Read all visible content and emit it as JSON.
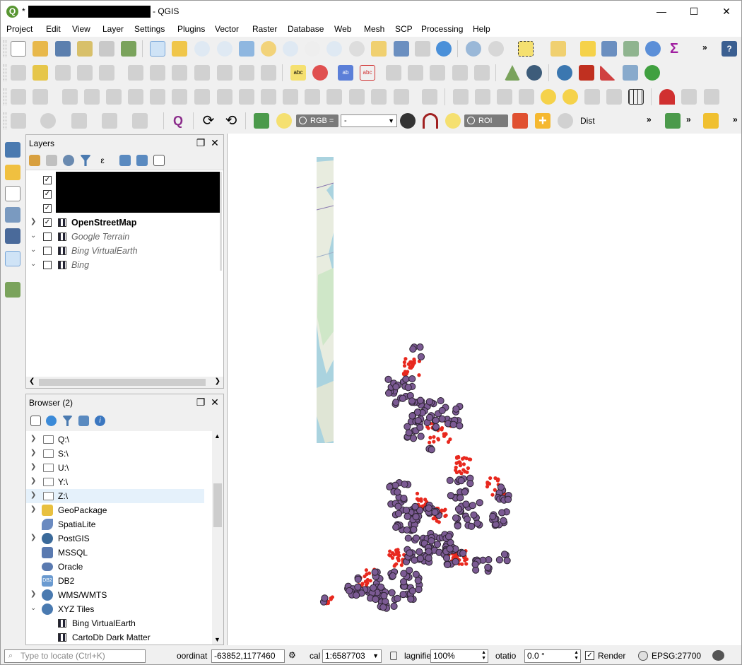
{
  "window": {
    "title_prefix": "*",
    "title_suffix": "- QGIS",
    "icon_letter": "Q",
    "minimize": "—",
    "maximize": "☐",
    "close": "✕"
  },
  "menu": [
    "Project",
    "Edit",
    "View",
    "Layer",
    "Settings",
    "Plugins",
    "Vector",
    "Raster",
    "Database",
    "Web",
    "Mesh",
    "SCP",
    "Processing",
    "Help"
  ],
  "toolbar4": {
    "rgb_label": "RGB =",
    "rgb_value": "-",
    "roi_label": "ROI",
    "dist_label": "Dist",
    "more": "»"
  },
  "layers_panel": {
    "title": "Layers",
    "layers": [
      {
        "name": "OpenStreetMap",
        "checked": true,
        "style": "bold"
      },
      {
        "name": "Google Terrain",
        "checked": false,
        "style": "italic"
      },
      {
        "name": "Bing VirtualEarth",
        "checked": false,
        "style": "italic"
      },
      {
        "name": "Bing",
        "checked": false,
        "style": "italic"
      }
    ]
  },
  "browser_panel": {
    "title": "Browser (2)",
    "items": [
      {
        "label": "Q:\\",
        "icon": "folder-icon",
        "expandable": true
      },
      {
        "label": "S:\\",
        "icon": "folder-icon",
        "expandable": true
      },
      {
        "label": "U:\\",
        "icon": "folder-icon",
        "expandable": true
      },
      {
        "label": "Y:\\",
        "icon": "folder-icon",
        "expandable": true
      },
      {
        "label": "Z:\\",
        "icon": "folder-icon",
        "expandable": true,
        "selected": true
      },
      {
        "label": "GeoPackage",
        "icon": "geopackage-icon",
        "expandable": true
      },
      {
        "label": "SpatiaLite",
        "icon": "spatialite-icon",
        "expandable": false
      },
      {
        "label": "PostGIS",
        "icon": "postgis-icon",
        "expandable": true
      },
      {
        "label": "MSSQL",
        "icon": "mssql-icon",
        "expandable": false
      },
      {
        "label": "Oracle",
        "icon": "oracle-icon",
        "expandable": false
      },
      {
        "label": "DB2",
        "icon": "db2-icon",
        "expandable": false
      },
      {
        "label": "WMS/WMTS",
        "icon": "globe-icon",
        "expandable": true
      },
      {
        "label": "XYZ Tiles",
        "icon": "globe-icon",
        "expandable": true,
        "expanded": true
      },
      {
        "label": "Bing VirtualEarth",
        "icon": "xyz-tile-icon",
        "child": true
      },
      {
        "label": "CartoDb Dark Matter",
        "icon": "xyz-tile-icon",
        "child": true
      }
    ]
  },
  "statusbar": {
    "locator_placeholder": "Type to locate (Ctrl+K)",
    "coordinate_label": "oordinat",
    "coordinate_value": "-63852,1177460",
    "scale_label": "cal",
    "scale_value": "1:6587703",
    "magnifier_label": "lagnifie",
    "magnifier_value": "100%",
    "rotation_label": "otatio",
    "rotation_value": "0.0 °",
    "render_label": "Render",
    "crs_label": "EPSG:27700"
  },
  "colors": {
    "point_fill": "#7b5a93",
    "point_stroke": "#2c2330",
    "red_points": "#e8281e",
    "map_water": "#aad3df",
    "qgis_green": "#589632"
  }
}
